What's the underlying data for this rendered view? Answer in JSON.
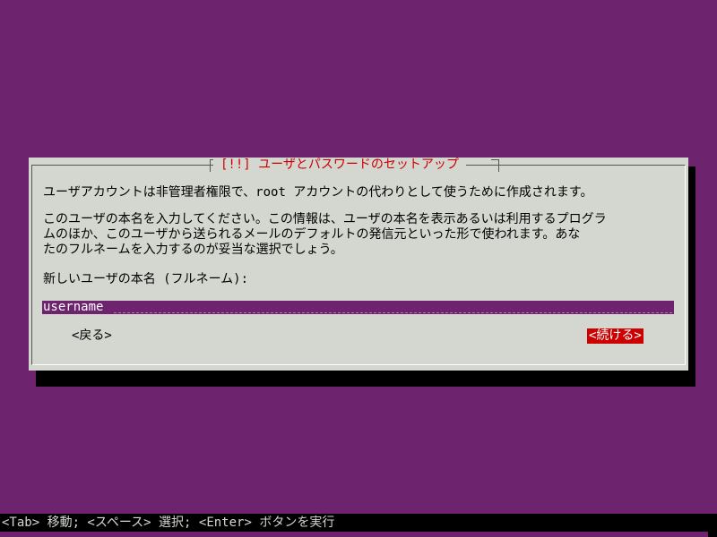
{
  "dialog": {
    "title": "[!!] ユーザとパスワードのセットアップ",
    "paragraph1": "ユーザアカウントは非管理者権限で、root アカウントの代わりとして使うために作成されます。",
    "paragraph2": [
      "このユーザの本名を入力してください。この情報は、ユーザの本名を表示あるいは利用するプログラ",
      "ムのほか、このユーザから送られるメールのデフォルトの発信元といった形で使われます。あな",
      "たのフルネームを入力するのが妥当な選択でしょう。"
    ],
    "prompt_label": "新しいユーザの本名 (フルネーム):",
    "input_value": "username",
    "back_button": "<戻る>",
    "continue_button": "<続ける>"
  },
  "status_bar": {
    "help_text": "<Tab> 移動; <スペース> 選択; <Enter> ボタンを実行"
  },
  "colors": {
    "background": "#6e236e",
    "dialog": "#d3d7cf",
    "accent": "#cc0000"
  }
}
